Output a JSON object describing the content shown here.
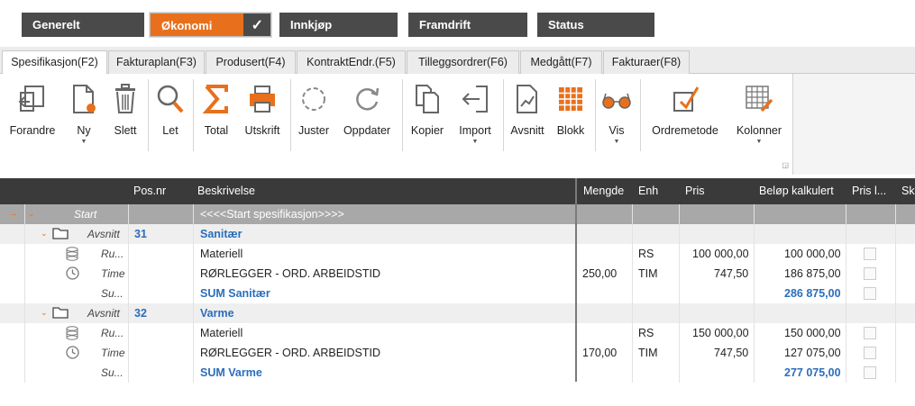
{
  "nav": [
    {
      "label": "Generelt",
      "active": false
    },
    {
      "label": "Økonomi",
      "active": true
    },
    {
      "label": "Innkjøp",
      "active": false
    },
    {
      "label": "Framdrift",
      "active": false
    },
    {
      "label": "Status",
      "active": false
    }
  ],
  "tabs": [
    "Spesifikasjon(F2)",
    "Fakturaplan(F3)",
    "Produsert(F4)",
    "KontraktEndr.(F5)",
    "Tilleggsordrer(F6)",
    "Medgått(F7)",
    "Fakturaer(F8)"
  ],
  "ribbon": {
    "forandre": "Forandre",
    "ny": "Ny",
    "slett": "Slett",
    "let": "Let",
    "total": "Total",
    "utskrift": "Utskrift",
    "juster": "Juster",
    "oppdater": "Oppdater",
    "kopier": "Kopier",
    "import": "Import",
    "avsnitt": "Avsnitt",
    "blokk": "Blokk",
    "vis": "Vis",
    "ordremetode": "Ordremetode",
    "kolonner": "Kolonner"
  },
  "grid": {
    "headers": {
      "posnr": "Pos.nr",
      "beskrivelse": "Beskrivelse",
      "mengde": "Mengde",
      "enh": "Enh",
      "pris": "Pris",
      "belop": "Beløp kalkulert",
      "prisl": "Pris l...",
      "ska": "Ska"
    },
    "start": {
      "type": "Start",
      "text": "<<<<Start spesifikasjon>>>>"
    },
    "rows": [
      {
        "type": "Avsnitt",
        "pos": "31",
        "desc": "Sanitær",
        "mengde": "",
        "enh": "",
        "pris": "",
        "belop": ""
      },
      {
        "type": "Ru...",
        "pos": "",
        "desc": "Materiell",
        "mengde": "",
        "enh": "RS",
        "pris": "100 000,00",
        "belop": "100 000,00"
      },
      {
        "type": "Time",
        "pos": "",
        "desc": "RØRLEGGER - ORD. ARBEIDSTID",
        "mengde": "250,00",
        "enh": "TIM",
        "pris": "747,50",
        "belop": "186 875,00"
      },
      {
        "type": "Su...",
        "pos": "",
        "desc": "SUM Sanitær",
        "mengde": "",
        "enh": "",
        "pris": "",
        "belop": "286 875,00"
      },
      {
        "type": "Avsnitt",
        "pos": "32",
        "desc": "Varme",
        "mengde": "",
        "enh": "",
        "pris": "",
        "belop": ""
      },
      {
        "type": "Ru...",
        "pos": "",
        "desc": "Materiell",
        "mengde": "",
        "enh": "RS",
        "pris": "150 000,00",
        "belop": "150 000,00"
      },
      {
        "type": "Time",
        "pos": "",
        "desc": "RØRLEGGER - ORD. ARBEIDSTID",
        "mengde": "170,00",
        "enh": "TIM",
        "pris": "747,50",
        "belop": "127 075,00"
      },
      {
        "type": "Su...",
        "pos": "",
        "desc": "SUM Varme",
        "mengde": "",
        "enh": "",
        "pris": "",
        "belop": "277 075,00"
      }
    ]
  },
  "colors": {
    "accent": "#e8701c",
    "nav_bg": "#4a4a4a",
    "header_bg": "#3a3a3a",
    "link_blue": "#2a6ebb"
  }
}
